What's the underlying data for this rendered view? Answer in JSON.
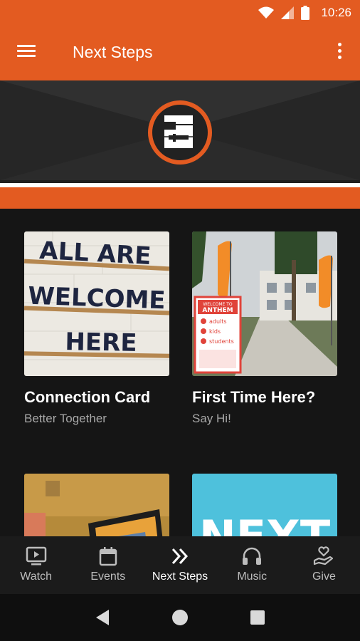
{
  "status_bar": {
    "time": "10:26",
    "icons": [
      "wifi-icon",
      "signal-icon",
      "battery-icon"
    ]
  },
  "app_bar": {
    "title": "Next Steps",
    "menu_icon": "hamburger-menu-icon",
    "overflow_icon": "more-vert-icon"
  },
  "banner": {
    "logo": "anthem-a-logo",
    "accent": "#e35b21"
  },
  "cards": [
    {
      "title": "Connection Card",
      "subtitle": "Better Together",
      "image": "letterboard-sign-image",
      "sign_lines": [
        "ALL ARE",
        "WELCOME",
        "HERE"
      ]
    },
    {
      "title": "First Time Here?",
      "subtitle": "Say Hi!",
      "image": "church-entrance-sign-image",
      "sign_lines": [
        "WELCOME TO",
        "ANTHEM",
        "adults",
        "kids",
        "students"
      ]
    },
    {
      "title": "",
      "subtitle": "",
      "image": "tablet-on-table-image"
    },
    {
      "title": "",
      "subtitle": "",
      "image": "next-graphic-image",
      "graphic_text": "NEXT"
    }
  ],
  "bottom_nav": [
    {
      "label": "Watch",
      "icon": "tv-play-icon",
      "active": false
    },
    {
      "label": "Events",
      "icon": "calendar-icon",
      "active": false
    },
    {
      "label": "Next Steps",
      "icon": "double-chevron-right-icon",
      "active": true
    },
    {
      "label": "Music",
      "icon": "headphones-icon",
      "active": false
    },
    {
      "label": "Give",
      "icon": "hand-heart-icon",
      "active": false
    }
  ],
  "system_nav": [
    "back-icon",
    "home-icon",
    "recents-icon"
  ],
  "colors": {
    "brand_orange": "#e35b21",
    "background": "#151515",
    "subtitle_gray": "#a8a8a8"
  }
}
